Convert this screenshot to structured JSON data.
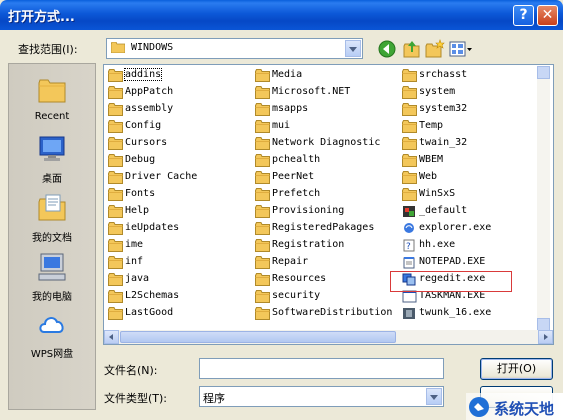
{
  "window": {
    "title": "打开方式..."
  },
  "titlebar": {
    "help": "?",
    "close": "✕"
  },
  "toolbar": {
    "lookin_label": "查找范围(I):",
    "lookin_value": "WINDOWS"
  },
  "places": [
    {
      "label": "Recent",
      "icon": "recent-folder-icon"
    },
    {
      "label": "桌面",
      "icon": "desktop-icon"
    },
    {
      "label": "我的文档",
      "icon": "my-documents-icon"
    },
    {
      "label": "我的电脑",
      "icon": "my-computer-icon"
    },
    {
      "label": "WPS网盘",
      "icon": "wps-cloud-icon"
    }
  ],
  "files": {
    "col1": [
      "addins",
      "AppPatch",
      "assembly",
      "Config",
      "Cursors",
      "Debug",
      "Driver Cache",
      "Fonts",
      "Help",
      "ieUpdates",
      "ime",
      "inf",
      "java",
      "L2Schemas",
      "LastGood"
    ],
    "col2": [
      "Media",
      "Microsoft.NET",
      "msapps",
      "mui",
      "Network Diagnostic",
      "pchealth",
      "PeerNet",
      "Prefetch",
      "Provisioning",
      "RegisteredPakages",
      "Registration",
      "Repair",
      "Resources",
      "security",
      "SoftwareDistribution"
    ],
    "col3": [
      {
        "name": "srchasst",
        "type": "folder"
      },
      {
        "name": "system",
        "type": "folder"
      },
      {
        "name": "system32",
        "type": "folder"
      },
      {
        "name": "Temp",
        "type": "folder"
      },
      {
        "name": "twain_32",
        "type": "folder"
      },
      {
        "name": "WBEM",
        "type": "folder"
      },
      {
        "name": "Web",
        "type": "folder"
      },
      {
        "name": "WinSxS",
        "type": "folder"
      },
      {
        "name": "_default",
        "type": "exe-default"
      },
      {
        "name": "explorer.exe",
        "type": "exe-explorer"
      },
      {
        "name": "hh.exe",
        "type": "exe-help"
      },
      {
        "name": "NOTEPAD.EXE",
        "type": "exe-notepad"
      },
      {
        "name": "regedit.exe",
        "type": "exe-regedit"
      },
      {
        "name": "TASKMAN.EXE",
        "type": "exe-taskman"
      },
      {
        "name": "twunk_16.exe",
        "type": "exe-twunk"
      }
    ]
  },
  "bottom": {
    "filename_label": "文件名(N):",
    "filename_value": "",
    "filetype_label": "文件类型(T):",
    "filetype_value": "程序",
    "open_button": "打开(O)",
    "cancel_button": ""
  },
  "watermark": {
    "text": "系统天地"
  },
  "colors": {
    "title_blue": "#0a55d6",
    "folder": "#f3c75a",
    "highlight_red": "#d93a3a"
  }
}
